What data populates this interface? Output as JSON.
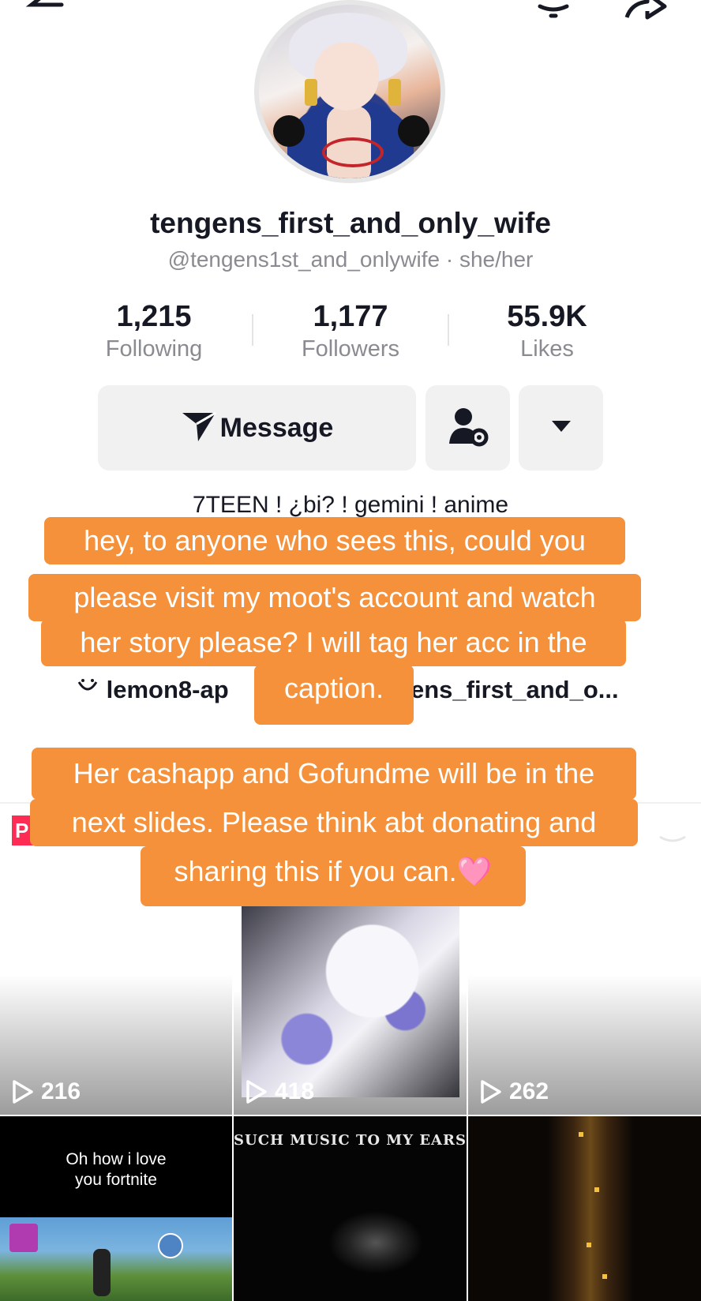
{
  "profile": {
    "display_name": "tengens_first_and_only_wife",
    "handle_line": "@tengens1st_and_onlywife · she/her"
  },
  "stats": [
    {
      "value": "1,215",
      "label": "Following"
    },
    {
      "value": "1,177",
      "label": "Followers"
    },
    {
      "value": "55.9K",
      "label": "Likes"
    }
  ],
  "actions": {
    "message_label": "Message"
  },
  "bio": {
    "line1": "7TEEN ! ¿bi? ! gemini ! anime",
    "link_left": "lemon8-ap",
    "link_right": "ens_first_and_o..."
  },
  "caption_block_1": {
    "line1": "hey, to anyone who sees this, could you",
    "line2": "please visit my moot's account and watch",
    "line3": "her story please? I will tag her acc in the",
    "line4": "caption."
  },
  "caption_block_2": {
    "line1": "Her cashapp and Gofundme will be in the",
    "line2": "next slides. Please think abt donating and",
    "line3": "sharing this if you can.",
    "emoji": "🩷"
  },
  "badge": {
    "text": "P"
  },
  "videos": [
    {
      "views": "216"
    },
    {
      "views": "418"
    },
    {
      "views": "262"
    },
    {
      "overlay_text_1": "Oh how i love",
      "overlay_text_2": "you fortnite"
    },
    {
      "overlay_text": "SUCH MUSIC TO MY EARS"
    },
    {}
  ],
  "colors": {
    "caption_bg": "#f5913b",
    "accent_red": "#fe2c55",
    "muted_text": "#8a8b91"
  },
  "icons": [
    "back-arrow-icon",
    "bell-icon",
    "share-icon",
    "send-icon",
    "add-friend-icon",
    "dropdown-icon",
    "play-icon",
    "link-icon"
  ]
}
